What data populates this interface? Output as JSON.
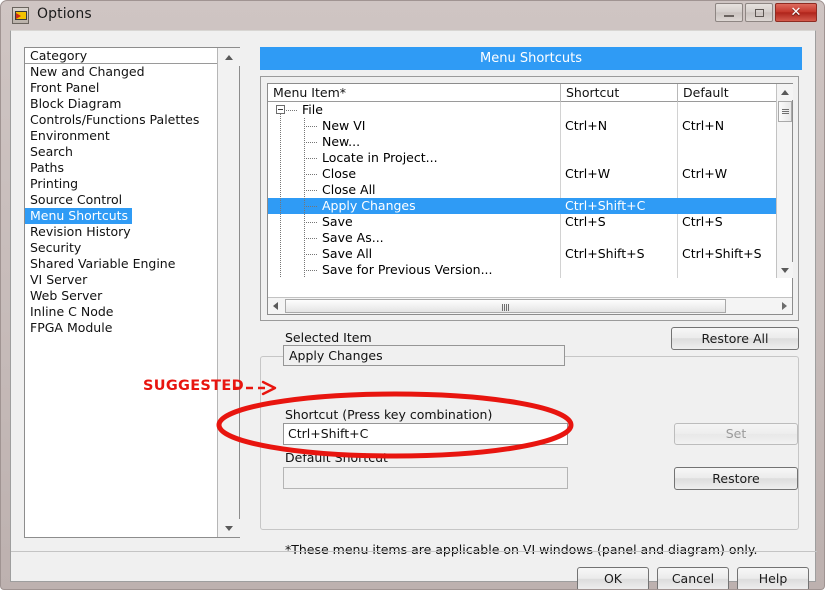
{
  "window": {
    "title": "Options",
    "icon": "labview-vi-icon",
    "controls": {
      "minimize": "–",
      "maximize": "□",
      "close": "✕"
    }
  },
  "category_panel": {
    "header": "Category",
    "items": [
      "New and Changed",
      "Front Panel",
      "Block Diagram",
      "Controls/Functions Palettes",
      "Environment",
      "Search",
      "Paths",
      "Printing",
      "Source Control",
      "Menu Shortcuts",
      "Revision History",
      "Security",
      "Shared Variable Engine",
      "VI Server",
      "Web Server",
      "Inline C Node",
      "FPGA Module"
    ],
    "selected": "Menu Shortcuts",
    "selected_color": "#2f9bf5"
  },
  "content": {
    "banner_title": "Menu Shortcuts",
    "banner_color": "#2f9bf5"
  },
  "tree": {
    "columns": [
      "Menu Item*",
      "Shortcut",
      "Default"
    ],
    "rows": [
      {
        "label": "File",
        "shortcut": "",
        "default": "",
        "depth": 0,
        "expander": "minus",
        "selected": false
      },
      {
        "label": "New VI",
        "shortcut": "Ctrl+N",
        "default": "Ctrl+N",
        "depth": 1,
        "expander": "none",
        "selected": false
      },
      {
        "label": "New...",
        "shortcut": "",
        "default": "",
        "depth": 1,
        "expander": "none",
        "selected": false
      },
      {
        "label": "Locate in Project...",
        "shortcut": "",
        "default": "",
        "depth": 1,
        "expander": "none",
        "selected": false
      },
      {
        "label": "Close",
        "shortcut": "Ctrl+W",
        "default": "Ctrl+W",
        "depth": 1,
        "expander": "none",
        "selected": false
      },
      {
        "label": "Close All",
        "shortcut": "",
        "default": "",
        "depth": 1,
        "expander": "none",
        "selected": false
      },
      {
        "label": "Apply Changes",
        "shortcut": "Ctrl+Shift+C",
        "default": "",
        "depth": 1,
        "expander": "none",
        "selected": true
      },
      {
        "label": "Save",
        "shortcut": "Ctrl+S",
        "default": "Ctrl+S",
        "depth": 1,
        "expander": "none",
        "selected": false
      },
      {
        "label": "Save As...",
        "shortcut": "",
        "default": "",
        "depth": 1,
        "expander": "none",
        "selected": false
      },
      {
        "label": "Save All",
        "shortcut": "Ctrl+Shift+S",
        "default": "Ctrl+Shift+S",
        "depth": 1,
        "expander": "none",
        "selected": false
      },
      {
        "label": "Save for Previous Version...",
        "shortcut": "",
        "default": "",
        "depth": 1,
        "expander": "none",
        "selected": false
      }
    ]
  },
  "form": {
    "selected_item_label": "Selected Item",
    "selected_item_value": "Apply Changes",
    "shortcut_label": "Shortcut (Press key combination)",
    "shortcut_value": "Ctrl+Shift+C",
    "default_shortcut_label": "Default Shortcut",
    "default_shortcut_value": "",
    "restore_all_button": "Restore All",
    "set_button": "Set",
    "set_button_enabled": false,
    "restore_button": "Restore"
  },
  "footnote": "*These menu items are applicable on VI windows (panel and diagram) only.",
  "dialog_buttons": {
    "ok": "OK",
    "cancel": "Cancel",
    "help": "Help"
  },
  "annotations": {
    "suggested_label": "SUGGESTED",
    "color": "#e8150f",
    "arrow": "dashed-arrow-right",
    "ellipse": "red-ellipse-around-default-shortcut"
  }
}
